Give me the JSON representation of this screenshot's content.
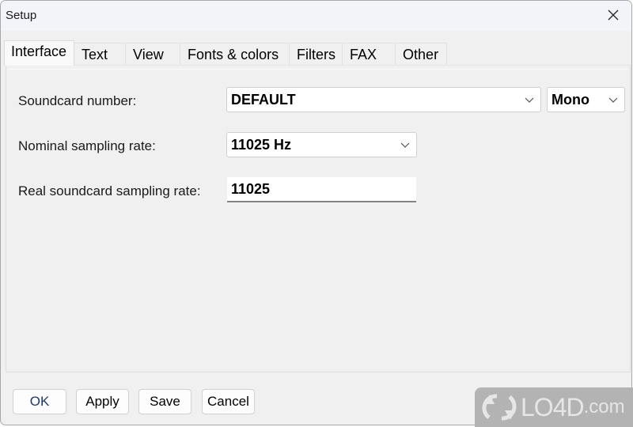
{
  "window": {
    "title": "Setup",
    "close_icon": "close-icon"
  },
  "tabs": [
    {
      "label": "Interface",
      "active": true
    },
    {
      "label": "Text",
      "active": false
    },
    {
      "label": "View",
      "active": false
    },
    {
      "label": "Fonts & colors",
      "active": false
    },
    {
      "label": "Filters",
      "active": false
    },
    {
      "label": "FAX",
      "active": false
    },
    {
      "label": "Other",
      "active": false
    }
  ],
  "form": {
    "soundcard": {
      "label": "Soundcard number:",
      "value": "DEFAULT",
      "channel_value": "Mono"
    },
    "nominal_rate": {
      "label": "Nominal sampling rate:",
      "value": "11025 Hz"
    },
    "real_rate": {
      "label": "Real soundcard sampling rate:",
      "value": "11025"
    }
  },
  "buttons": {
    "ok": "OK",
    "apply": "Apply",
    "save": "Save",
    "cancel": "Cancel"
  },
  "watermark": {
    "brand": "LO4D",
    "suffix": ".com"
  }
}
